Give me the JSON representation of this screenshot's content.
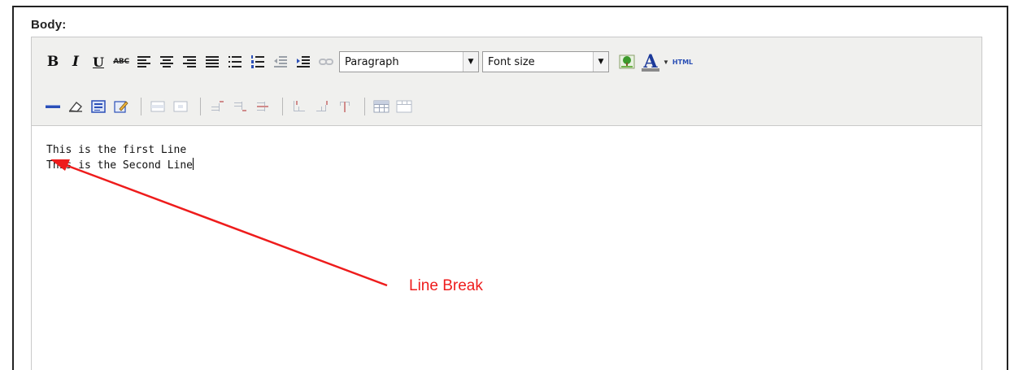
{
  "form": {
    "body_label": "Body:"
  },
  "toolbar": {
    "row1": {
      "bold_label": "B",
      "italic_label": "I",
      "underline_label": "U",
      "strikethrough_label": "ABC",
      "block_format": {
        "selected": "Paragraph"
      },
      "font_size": {
        "selected": "Font size"
      },
      "forecolor_label": "A",
      "html_label": "HTML"
    },
    "icons": {
      "row1": [
        "bold-icon",
        "italic-icon",
        "underline-icon",
        "strikethrough-icon",
        "align-left-icon",
        "align-center-icon",
        "align-right-icon",
        "align-justify-icon",
        "bullet-list-icon",
        "numbered-list-icon",
        "outdent-icon",
        "indent-icon",
        "unlink-icon",
        "image-icon",
        "text-color-icon",
        "html-source-icon"
      ],
      "row2": [
        "horizontal-rule-icon",
        "eraser-icon",
        "visual-aid-icon",
        "edit-icon",
        "table-row-props-icon",
        "table-cell-props-icon",
        "insert-row-before-icon",
        "insert-row-after-icon",
        "delete-row-icon",
        "insert-col-before-icon",
        "insert-col-after-icon",
        "delete-col-icon",
        "table-icon",
        "merge-cells-icon"
      ]
    },
    "forecolor_bar_color": "#8a8a8a"
  },
  "content": {
    "lines": [
      "This is the first Line",
      "This is the Second Line"
    ]
  },
  "annotation": {
    "label": "Line Break",
    "color": "#ee1c1c"
  }
}
